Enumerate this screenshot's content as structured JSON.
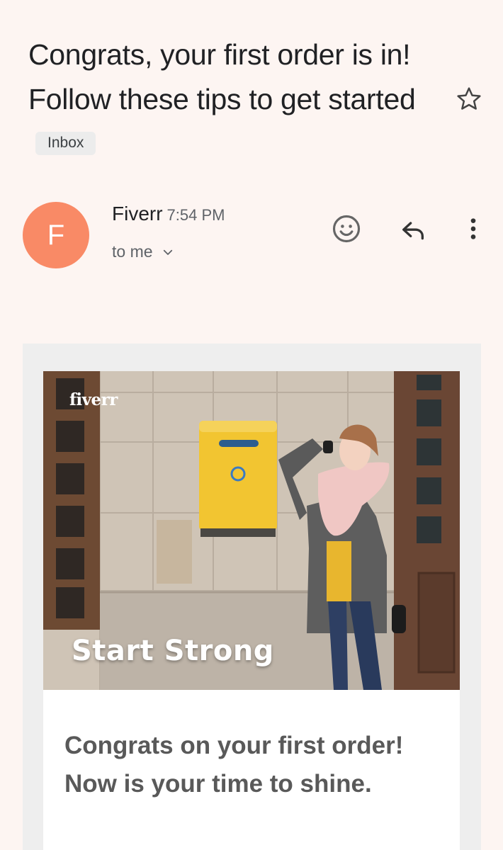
{
  "email": {
    "subject": "Congrats, your first order is in! Follow these tips to get started",
    "label": "Inbox",
    "sender": {
      "initial": "F",
      "name": "Fiverr",
      "time": "7:54 PM",
      "recipient": "to me",
      "avatar_color": "#f98a66"
    },
    "icons": {
      "star": "star-outline-icon",
      "emoji": "emoji-smile-icon",
      "reply": "reply-icon",
      "more": "more-vert-icon",
      "expand": "chevron-down-icon"
    }
  },
  "body": {
    "hero": {
      "logo": "fiverr",
      "title": "Start Strong"
    },
    "heading": "Congrats on your first order! Now is your time to shine."
  },
  "colors": {
    "background": "#fdf5f2",
    "frame": "#eeeeee",
    "heading_text": "#595959",
    "mailbox_yellow": "#f2c531"
  }
}
